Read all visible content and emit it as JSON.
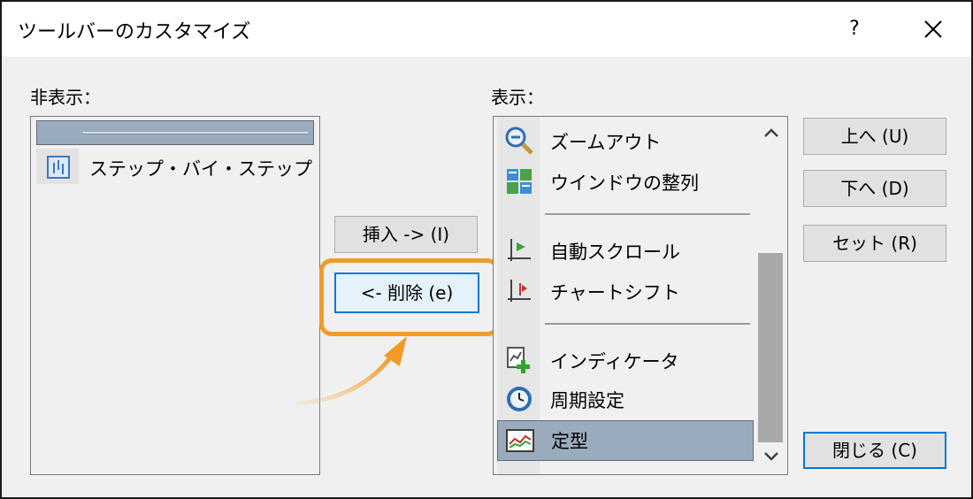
{
  "window": {
    "title": "ツールバーのカスタマイズ",
    "help_label": "?",
    "close_icon": "close-icon"
  },
  "hidden_panel": {
    "label": "非表示：",
    "items": [
      {
        "type": "separator",
        "selected": true
      },
      {
        "type": "item",
        "label": "ステップ・バイ・ステップ",
        "icon": "step-by-step-icon"
      }
    ]
  },
  "shown_panel": {
    "label": "表示：",
    "items": [
      {
        "type": "item",
        "label": "ズームアウト",
        "icon": "zoom-out-icon"
      },
      {
        "type": "item",
        "label": "ウインドウの整列",
        "icon": "tile-windows-icon"
      },
      {
        "type": "separator"
      },
      {
        "type": "item",
        "label": "自動スクロール",
        "icon": "auto-scroll-icon"
      },
      {
        "type": "item",
        "label": "チャートシフト",
        "icon": "chart-shift-icon"
      },
      {
        "type": "separator"
      },
      {
        "type": "item",
        "label": "インディケータ",
        "icon": "indicator-add-icon"
      },
      {
        "type": "item",
        "label": "周期設定",
        "icon": "period-clock-icon"
      },
      {
        "type": "item",
        "label": "定型",
        "icon": "template-icon",
        "selected": true
      }
    ]
  },
  "buttons": {
    "insert": "挿入 -> (I)",
    "remove": "<- 削除 (e)",
    "up": "上へ (U)",
    "down": "下へ (D)",
    "reset": "セット (R)",
    "close": "閉じる (C)"
  },
  "colors": {
    "highlight": "#f29b27",
    "selection": "#9aabbd",
    "focus_border": "#0078d7"
  }
}
